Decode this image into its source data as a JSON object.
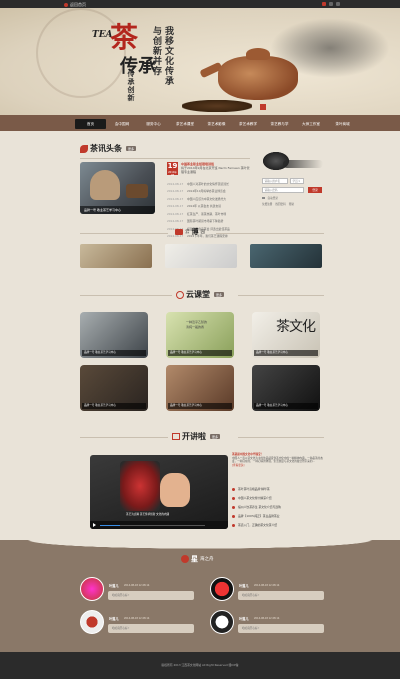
{
  "topbar": {
    "home_label": "返回首页"
  },
  "hero": {
    "tea_word": "TEA",
    "big1": "茶",
    "big2": "传承",
    "vert1": "我移文化传承",
    "vert2": "与创新并存",
    "vert3": "传承创新"
  },
  "nav": {
    "items": [
      "首页",
      "会中国网",
      "服务中心",
      "茶艺术课堂",
      "茶艺术影像",
      "茶艺术教学",
      "茶艺教与学",
      "大师工作室",
      "茶叶商城"
    ],
    "active": 0
  },
  "news": {
    "title": "茶讯头条",
    "more": "更多",
    "date_day": "19",
    "date_month": "2014年08",
    "lead_title": "中国茶业职业经理培训班",
    "lead_text": "将于2014年9月在北京开班 Nerm Ferneen 茶叶管理专业课程",
    "image_caption": "品牌一号 敬业茶艺学习中心",
    "rows": [
      {
        "date": "2014-08-17",
        "text": "中国人对茶叶的文化情怀源远流长"
      },
      {
        "date": "2014-08-17",
        "text": "2014年10月将举办茶业博览会"
      },
      {
        "date": "2014-08-17",
        "text": "中国人应该为中茶文化发扬光大"
      },
      {
        "date": "2014-08-17",
        "text": "2014年 以茶会友 共建友谊"
      },
      {
        "date": "2014-08-17",
        "text": "红茶生产、黑茶热销、茶叶市场"
      },
      {
        "date": "2014-08-17",
        "text": "国际茶叶期货市场呈下降趋势"
      },
      {
        "date": "2014-08-17",
        "text": "福建铁观音品茶会 评选出最佳茶品"
      },
      {
        "date": "2014-08-17",
        "text": "2014下半年，我们茶艺课程安排"
      }
    ]
  },
  "login": {
    "user_placeholder": "请输入用户名",
    "type_label": "学员",
    "pass_placeholder": "请输入密码",
    "remember": "自动登录",
    "login_btn": "登录",
    "links": [
      "免费注册",
      "找回密码",
      "帮助"
    ]
  },
  "blog": {
    "title": "云",
    "title2": "博",
    "subtitle": "园"
  },
  "classroom": {
    "title": "云课堂",
    "more": "更多",
    "captions": [
      "品牌一号 敬业茶艺学习中心",
      "品牌一号 敬业茶艺学习中心",
      "品牌一号 敬业茶艺学习中心",
      "品牌一号 敬业茶艺学习中心",
      "品牌一号 敬业茶艺学习中心",
      "品牌一号 敬业茶艺学习中心"
    ],
    "texts": [
      "一种近乎乙醇的",
      "清纯一般的香",
      "茶文化"
    ]
  },
  "talk": {
    "title": "开讲啦",
    "more": "更多",
    "video_caption": "茶艺为点睛 茶艺传承创新 文化的内涵",
    "lead_title": "茶就是中国文化中华瑰宝！",
    "lead_text": "中国人一直以茶文化为主的饮品感受到茶文化中的一种精神内涵，一种品茶的态度，一种自在的，一种心情的体现，生活态度与茶文化的融合所带来的...",
    "lead_more": "[查看更多]",
    "rows": [
      "茶叶茶叶高端品牌 精华茶",
      "中国人茶文化博大精深介绍",
      "福州人饮茶养生 茶文化介绍与选购",
      "品牌【100%纯正】茶业品牌茶业",
      "茶道入门，正确的茶文化茶介绍"
    ]
  },
  "star": {
    "title": "星",
    "subtitle": "海之舟",
    "cards": [
      {
        "name": "叶落儿",
        "time": "2014-08-18 12:28:14",
        "text": "哈哈真开心好 !"
      },
      {
        "name": "叶落儿",
        "time": "2014-08-18 12:28:14",
        "text": "哈哈真开心好 !"
      },
      {
        "name": "叶落儿",
        "time": "2014-08-18 12:28:14",
        "text": "哈哈真开心好 !"
      },
      {
        "name": "叶落儿",
        "time": "2014-08-18 12:28:14",
        "text": "哈哈真开心好 !"
      }
    ]
  },
  "footer": {
    "text": "版权所有 2013 江西茶文化网站 All Right Reserved 赣ICP备"
  }
}
